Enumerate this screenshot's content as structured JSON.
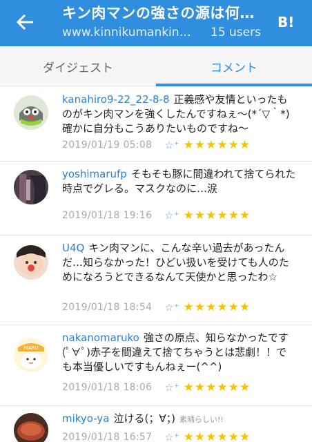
{
  "header": {
    "title": "キン肉マンの強さの源は何…",
    "url": "www.kinnikumankin…",
    "users": "15 users",
    "bookmark_label": "B!"
  },
  "tabs": [
    {
      "label": "ダイジェスト"
    },
    {
      "label": "コメント"
    }
  ],
  "comments": [
    {
      "user": "kanahiro9-22_22-8-8",
      "text": "正義感や友情といったものがキン肉マンを強くしたんですねぇ～(*´▽｀*)確かに自分もこうありたいものですね～",
      "date": "2019/01/19 05:08",
      "stars": "★★★★★★"
    },
    {
      "user": "yoshimarufp",
      "text": "そもそも豚に間違われて捨てられた時点でグレる。マスクなのに…涙",
      "date": "2019/01/18 19:16",
      "stars": "★★★★★★"
    },
    {
      "user": "U4Q",
      "text": "キン肉マンに、こんな辛い過去があったんだ…知らなかった！ひどい扱いを受けても人のためになろうとできるなんて天使かと思ったわ☆",
      "date": "2019/01/18 18:54",
      "stars": "★★★★★★"
    },
    {
      "user": "nakanomaruko",
      "text": "強さの原点、知らなかったです(ﾟ∀ﾟ)赤子を間違えて捨てちゃうとは悲劇！！でも本当優しいですもんねぇー(^^)",
      "date": "2019/01/18 18:06",
      "stars": "★★★★★★"
    },
    {
      "user": "mikyo-ya",
      "text": "泣ける(；∀；)",
      "extra": "素晴らしい!!",
      "date": "2019/01/18 16:57",
      "stars": "★★★★★★"
    }
  ],
  "icons": {
    "back": "arrow-left-icon",
    "add_star": "add-star-icon"
  },
  "colors": {
    "brand": "#2f8ede",
    "star": "#f5c400",
    "username": "#2b7fcb"
  }
}
